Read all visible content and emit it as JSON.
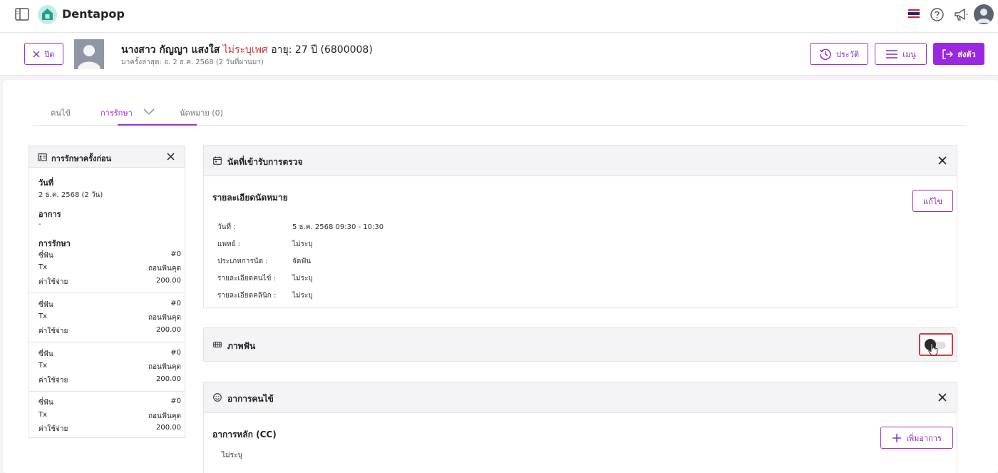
{
  "app": {
    "brand": "Dentapop"
  },
  "header": {
    "close_label": "ปิด",
    "patient": {
      "title_name": "นางสาว กัญญา แสงใส",
      "gender": "ไม่ระบุเพศ",
      "age": "อายุ: 27 ปี",
      "id": "(6800008)",
      "last_visit": "มาครั้งล่าสุด: อ. 2 ธ.ค. 2568 (2 วันที่ผ่านมา)"
    },
    "history_label": "ประวัติ",
    "menu_label": "เมนู",
    "send_label": "ส่งตัว",
    "colors": {
      "accent": "#9b27e0",
      "gender": "#d13a3a"
    }
  },
  "tabs": [
    {
      "label": "คนไข้"
    },
    {
      "label": "การรักษา"
    },
    {
      "label": "นัดหมาย (0)"
    }
  ],
  "previous_treatment": {
    "title": "การรักษาครั้งก่อน",
    "date_label": "วันที่",
    "date_value": "2 ธ.ค. 2568 (2 วัน)",
    "symptom_label": "อาการ",
    "symptom_value": "-",
    "treatment_label": "การรักษา",
    "items": [
      {
        "tooth_label": "ซี่ฟัน",
        "tooth_value": "#0",
        "tx_label": "Tx",
        "tx_value": "ถอนฟันคุด",
        "cost_label": "ค่าใช้จ่าย",
        "cost_value": "200.00"
      },
      {
        "tooth_label": "ซี่ฟัน",
        "tooth_value": "#0",
        "tx_label": "Tx",
        "tx_value": "ถอนฟันคุด",
        "cost_label": "ค่าใช้จ่าย",
        "cost_value": "200.00"
      },
      {
        "tooth_label": "ซี่ฟัน",
        "tooth_value": "#0",
        "tx_label": "Tx",
        "tx_value": "ถอนฟันคุด",
        "cost_label": "ค่าใช้จ่าย",
        "cost_value": "200.00"
      },
      {
        "tooth_label": "ซี่ฟัน",
        "tooth_value": "#0",
        "tx_label": "Tx",
        "tx_value": "ถอนฟันคุด",
        "cost_label": "ค่าใช้จ่าย",
        "cost_value": "200.00"
      }
    ]
  },
  "appointment_panel": {
    "title": "นัดที่เข้ารับการตรวจ",
    "subheading": "รายละเอียดนัดหมาย",
    "edit_label": "แก้ไข",
    "rows": [
      {
        "key": "วันที่ :",
        "value": "5 ธ.ค. 2568  09:30 - 10:30"
      },
      {
        "key": "แพทย์ :",
        "value": "ไม่ระบุ"
      },
      {
        "key": "ประเภทการนัด :",
        "value": "จัดฟัน"
      },
      {
        "key": "รายละเอียดคนไข้ :",
        "value": "ไม่ระบุ"
      },
      {
        "key": "รายละเอียดคลินิก :",
        "value": "ไม่ระบุ"
      }
    ]
  },
  "teeth_image_panel": {
    "title": "ภาพฟัน"
  },
  "symptom_panel": {
    "title": "อาการคนไข้",
    "subheading": "อาการหลัก (CC)",
    "add_label": "เพิ่มอาการ",
    "value": "ไม่ระบุ"
  }
}
